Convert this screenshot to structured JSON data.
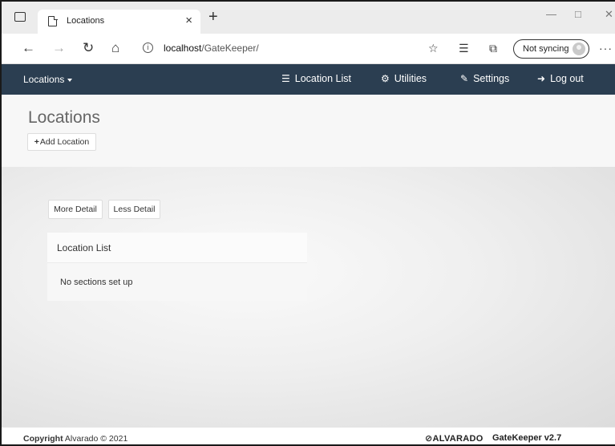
{
  "browser": {
    "tab_title": "Locations",
    "tab_close": "×",
    "new_tab": "+",
    "url_host": "localhost",
    "url_path": "/GateKeeper/",
    "sync_label": "Not syncing",
    "more_label": "···",
    "window_buttons": {
      "minimize": "—",
      "maximize": "□",
      "close": "✕"
    },
    "nav": {
      "back": "←",
      "forward": "→",
      "refresh": "↻",
      "home": "⌂"
    },
    "toolbar_icons": {
      "favorite": "☆",
      "favorites": "☰",
      "collections": "⧉"
    }
  },
  "navbar": {
    "brand": "Locations",
    "links": [
      {
        "label": "Location List",
        "icon": "list-icon",
        "glyph": "☰"
      },
      {
        "label": "Utilities",
        "icon": "cogs-icon",
        "glyph": "⚙"
      },
      {
        "label": "Settings",
        "icon": "wrench-icon",
        "glyph": "✎"
      },
      {
        "label": "Log out",
        "icon": "sign-out-icon",
        "glyph": "➜"
      }
    ]
  },
  "header": {
    "title": "Locations",
    "add_button": "Add Location",
    "add_button_plus": "+"
  },
  "content": {
    "more_detail": "More Detail",
    "less_detail": "Less Detail",
    "panel_title": "Location List",
    "panel_empty": "No sections set up"
  },
  "footer": {
    "copyright_bold": "Copyright",
    "copyright_rest": " Alvarado © 2021",
    "logo": "⊘ALVARADO",
    "version": "GateKeeper v2.7"
  },
  "colors": {
    "navbar_bg": "#2b3e51",
    "page_header_bg": "#f7f7f7",
    "content_bg": "#e6e6e6"
  }
}
